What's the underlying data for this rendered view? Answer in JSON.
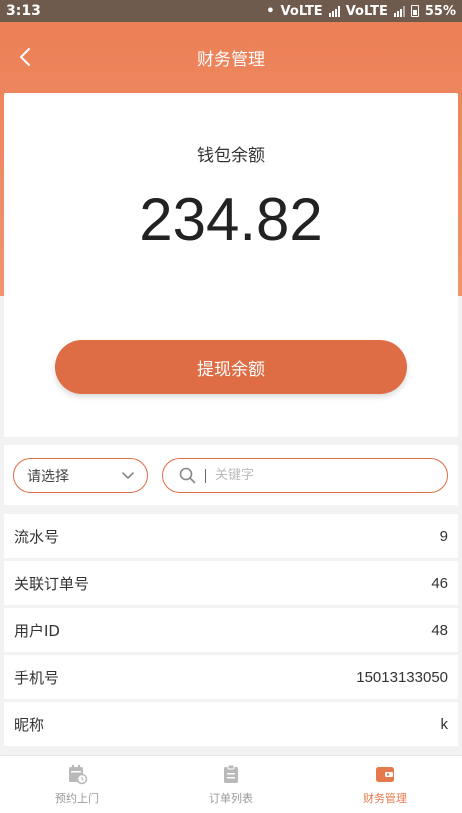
{
  "status_bar": {
    "time": "3:13",
    "network_1": "VoLTE",
    "network_2": "VoLTE",
    "battery": "55%"
  },
  "header": {
    "title": "财务管理",
    "back_icon": "chevron-left-icon"
  },
  "wallet": {
    "label": "钱包余额",
    "amount": "234.82",
    "withdraw_label": "提现余额"
  },
  "filters": {
    "select_value": "请选择",
    "search_placeholder": "关键字",
    "search_value": ""
  },
  "details": [
    {
      "label": "流水号",
      "value": "9"
    },
    {
      "label": "关联订单号",
      "value": "46"
    },
    {
      "label": "用户ID",
      "value": "48"
    },
    {
      "label": "手机号",
      "value": "15013133050"
    },
    {
      "label": "昵称",
      "value": "k"
    }
  ],
  "tabs": [
    {
      "label": "预约上门",
      "icon": "calendar-icon",
      "active": false
    },
    {
      "label": "订单列表",
      "icon": "clipboard-icon",
      "active": false
    },
    {
      "label": "财务管理",
      "icon": "wallet-icon",
      "active": true
    }
  ],
  "colors": {
    "accent": "#de6c45",
    "header_gradient_top": "#ec7e55",
    "active_tab": "#e57a4e"
  }
}
